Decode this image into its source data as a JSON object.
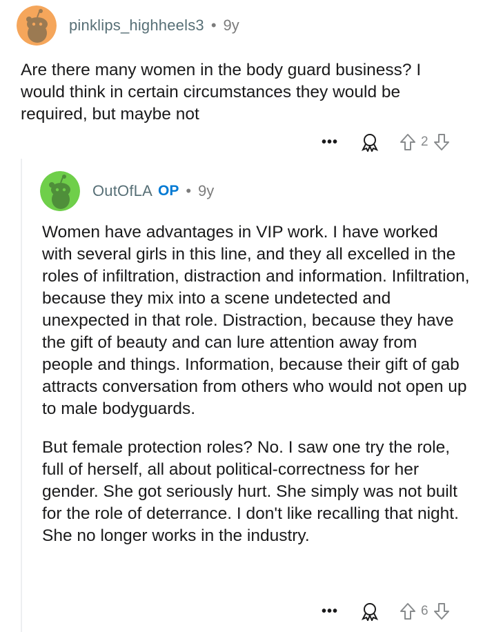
{
  "comments": [
    {
      "username": "pinklips_highheels3",
      "separator": "•",
      "age": "9y",
      "body": "Are there many women in the body guard business? I would think in certain circumstances they would be required, but maybe not",
      "more_label": "•••",
      "upvotes": "2",
      "avatar_color": "#f5a65b"
    },
    {
      "username": "OutOfLA",
      "op_badge": "OP",
      "separator": "•",
      "age": "9y",
      "body_p1": "Women have advantages in VIP work. I have worked with several girls in this line, and they all excelled in the roles of infiltration, distraction and information. Infiltration, because they mix into a scene undetected and unexpected in that role. Distraction, because they have the gift of beauty and can lure attention away from people and things. Information, because their gift of gab attracts conversation from others who would not open up to male bodyguards.",
      "body_p2": "But female protection roles? No. I saw one try the role, full of herself, all about political-correctness for her gender. She got seriously hurt. She simply was not built for the role of deterrance. I don't like recalling that night. She no longer works in the industry.",
      "more_label": "•••",
      "upvotes": "6",
      "avatar_color": "#6fcf4a"
    }
  ],
  "icons": {
    "award": "award-icon",
    "upvote": "upvote-arrow-icon",
    "downvote": "downvote-arrow-icon",
    "more": "more-options-icon"
  }
}
